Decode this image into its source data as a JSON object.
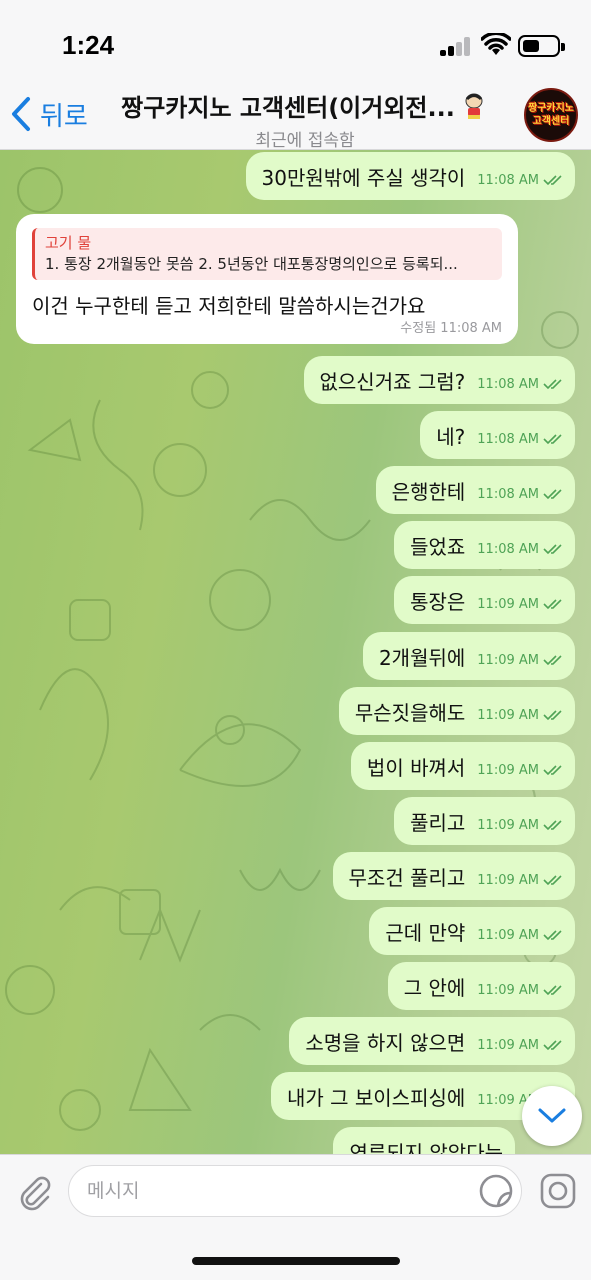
{
  "status_bar": {
    "time": "1:24"
  },
  "header": {
    "back_label": "뒤로",
    "title": "짱구카지노 고객센터(이거외전...",
    "subtitle": "최근에 접속함",
    "avatar_text": "짱구카지노 고객센터"
  },
  "messages": [
    {
      "type": "out",
      "text": "30만원밖에 주실 생각이",
      "time": "11:08 AM"
    },
    {
      "type": "in",
      "reply_name": "고기 물",
      "reply_text": "1. 통장 2개월동안 못씀 2. 5년동안 대포통장명의인으로 등록되...",
      "text": "이건 누구한테 듣고 저희한테 말씀하시는건가요",
      "meta": "수정됨 11:08 AM"
    },
    {
      "type": "out",
      "text": "없으신거죠 그럼?",
      "time": "11:08 AM"
    },
    {
      "type": "out",
      "text": "네?",
      "time": "11:08 AM"
    },
    {
      "type": "out",
      "text": "은행한테",
      "time": "11:08 AM"
    },
    {
      "type": "out",
      "text": "들었죠",
      "time": "11:08 AM"
    },
    {
      "type": "out",
      "text": "통장은",
      "time": "11:09 AM"
    },
    {
      "type": "out",
      "text": "2개월뒤에",
      "time": "11:09 AM"
    },
    {
      "type": "out",
      "text": "무슨짓을해도",
      "time": "11:09 AM"
    },
    {
      "type": "out",
      "text": "법이 바껴서",
      "time": "11:09 AM"
    },
    {
      "type": "out",
      "text": "풀리고",
      "time": "11:09 AM"
    },
    {
      "type": "out",
      "text": "무조건 풀리고",
      "time": "11:09 AM"
    },
    {
      "type": "out",
      "text": "근데 만약",
      "time": "11:09 AM"
    },
    {
      "type": "out",
      "text": "그 안에",
      "time": "11:09 AM"
    },
    {
      "type": "out",
      "text": "소명을 하지 않으면",
      "time": "11:09 AM"
    },
    {
      "type": "out",
      "text": "내가 그 보이스피싱에",
      "time": "11:09 AM"
    },
    {
      "type": "out",
      "text": "연루되지 않았다는",
      "time": ""
    }
  ],
  "composer": {
    "placeholder": "메시지"
  },
  "colors": {
    "accent": "#1a7ee0",
    "outgoing_bubble": "#e1fbc9",
    "tick_green": "#4fa356",
    "reply_red": "#e0423a"
  }
}
